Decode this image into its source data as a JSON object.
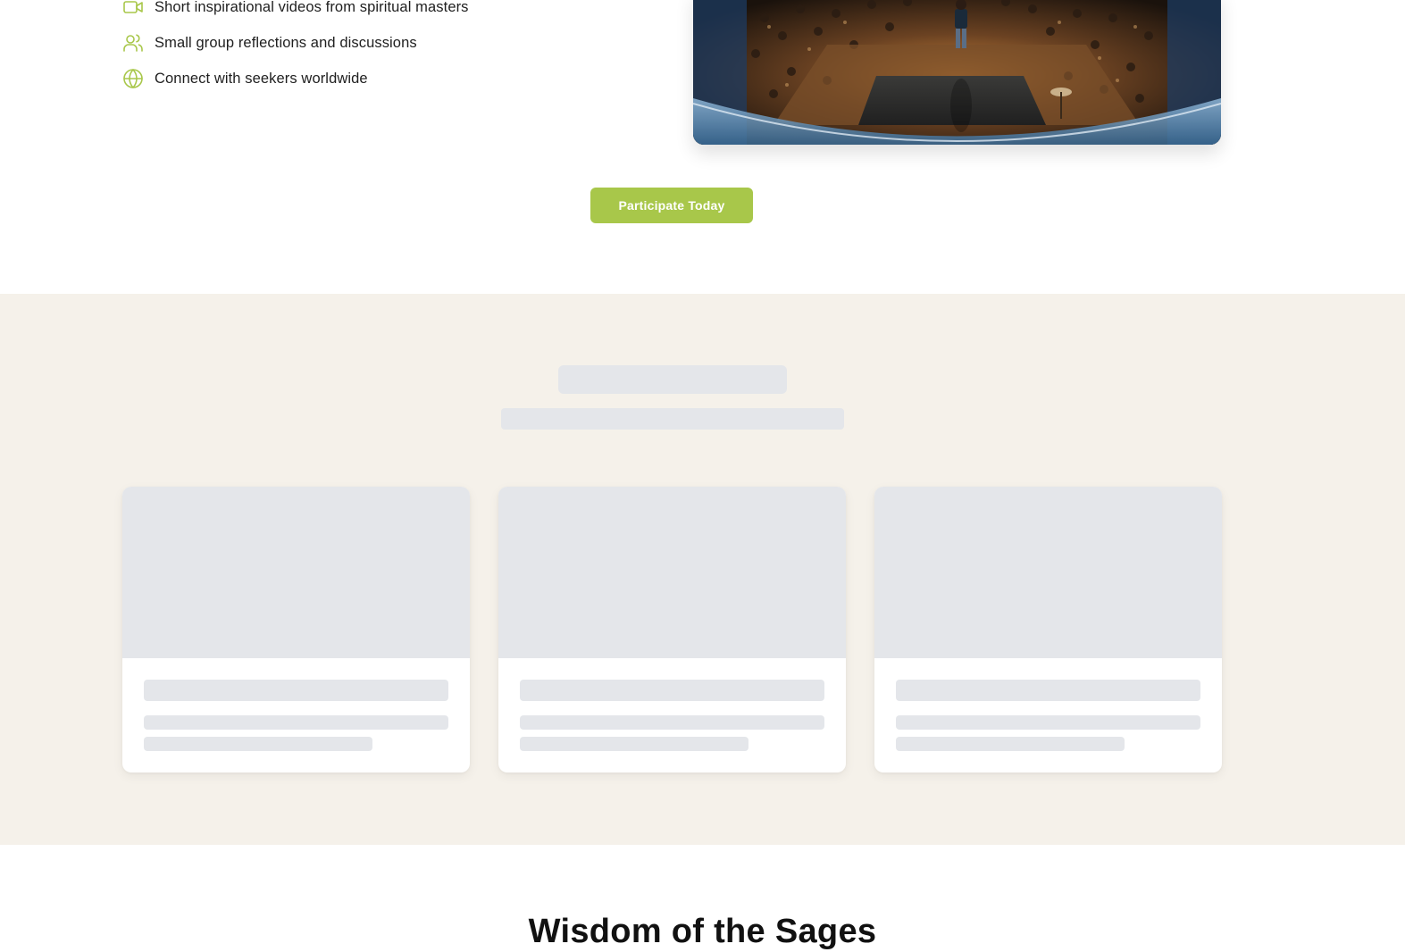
{
  "features": {
    "items": [
      {
        "icon": "video-camera-icon",
        "label": "Short inspirational videos from spiritual masters"
      },
      {
        "icon": "users-icon",
        "label": "Small group reflections and discussions"
      },
      {
        "icon": "globe-icon",
        "label": "Connect with seekers worldwide"
      }
    ]
  },
  "hero": {
    "image": "speaker on stage before audience"
  },
  "cta": {
    "label": "Participate Today"
  },
  "colors": {
    "accent": "#a8c74a",
    "skeleton": "#e4e6ea",
    "section_bg": "#f5f1ea"
  },
  "wisdom": {
    "heading": "Wisdom of the Sages"
  }
}
